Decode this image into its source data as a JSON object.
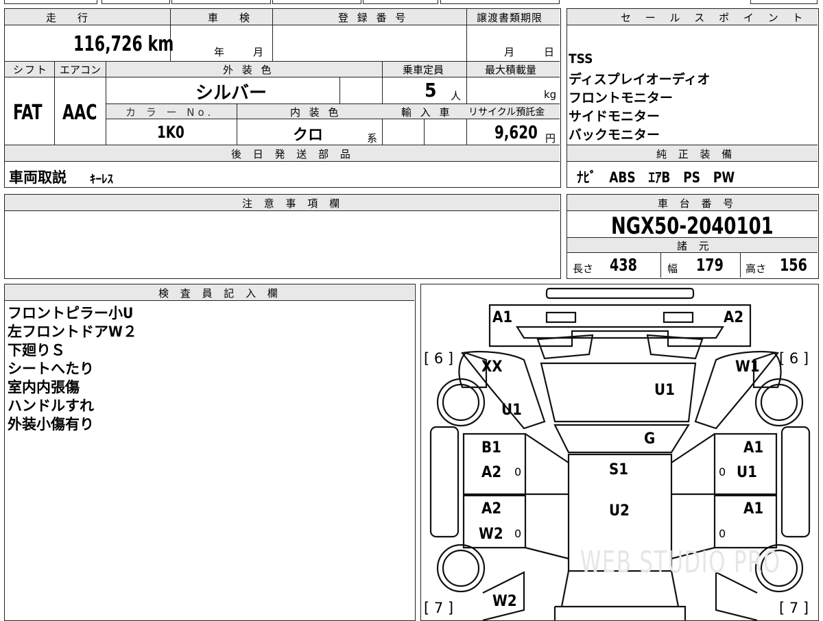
{
  "vehicle": {
    "mileage_label": "走　行",
    "mileage": "116,726 km",
    "inspection_label": "車　検",
    "inspection_year": "年",
    "inspection_month": "月",
    "registration_label": "登 録 番 号",
    "registration_value": "",
    "transfer_label": "譲渡書類期限",
    "transfer_month": "月",
    "transfer_day": "日",
    "shift_label": "シフト",
    "shift": "FAT",
    "aircon_label": "エアコン",
    "aircon": "AAC",
    "exterior_color_label": "外 装 色",
    "exterior_color": "シルバー",
    "capacity_label": "乗車定員",
    "capacity": "5",
    "capacity_unit": "人",
    "max_load_label": "最大積載量",
    "max_load_unit": "kg",
    "color_no_label": "カ ラ ー No.",
    "color_no": "1K0",
    "interior_color_label": "内 装 色",
    "interior_color": "クロ",
    "interior_suffix": "系",
    "import_label": "輸 入 車",
    "recycle_label": "リサイクル預託金",
    "recycle_fee": "9,620",
    "recycle_unit": "円",
    "parts_label": "後 日 発 送 部 品",
    "parts_main": "車両取説",
    "parts_sub": "ｷｰﾚｽ"
  },
  "sales_points": {
    "label": "セ ー ル ス ポ イ ン ト",
    "items": [
      "TSS",
      "ディスプレイオーディオ",
      "フロントモニター",
      "サイドモニター",
      "バックモニター"
    ]
  },
  "standard_equipment": {
    "label": "純 正 装 備",
    "value": "ﾅﾋﾞ　ABS　ｴｱB　PS　PW"
  },
  "notes": {
    "label": "注 意 事 項 欄",
    "value": ""
  },
  "chassis": {
    "label": "車 台 番 号",
    "number": "NGX50-2040101",
    "specs_label": "諸 元",
    "length_label": "長さ",
    "length": "438",
    "width_label": "幅",
    "width": "179",
    "height_label": "高さ",
    "height": "156"
  },
  "inspector": {
    "label": "検 査 員 記 入 欄",
    "lines": [
      "フロントピラー小U",
      "左フロントドアW２",
      "下廻りＳ",
      "シートへたり",
      "室内内張傷",
      "ハンドルすれ",
      "外装小傷有り"
    ]
  },
  "damage_map": {
    "front_left": "A1",
    "front_right": "A2",
    "left_fender": "XX",
    "right_fender": "W1",
    "left_a_pillar": "U1",
    "windshield": "U1",
    "dashboard": "G",
    "front_left_door_a": "B1",
    "front_left_door_b": "A2",
    "front_right_door_a": "A1",
    "front_right_door_b": "U1",
    "seat": "S1",
    "floor": "U2",
    "rear_left_door_a": "A2",
    "rear_left_door_b": "W2",
    "rear_right_door": "A1",
    "rear_left_quarter": "W2",
    "tire_front_left": "[ 6 ]",
    "tire_front_right": "[ 6 ]",
    "tire_rear_left": "[ 7 ]",
    "tire_rear_right": "[ 7 ]",
    "zero_mark": "0",
    "watermark": "WEB STUDIO PRO"
  }
}
